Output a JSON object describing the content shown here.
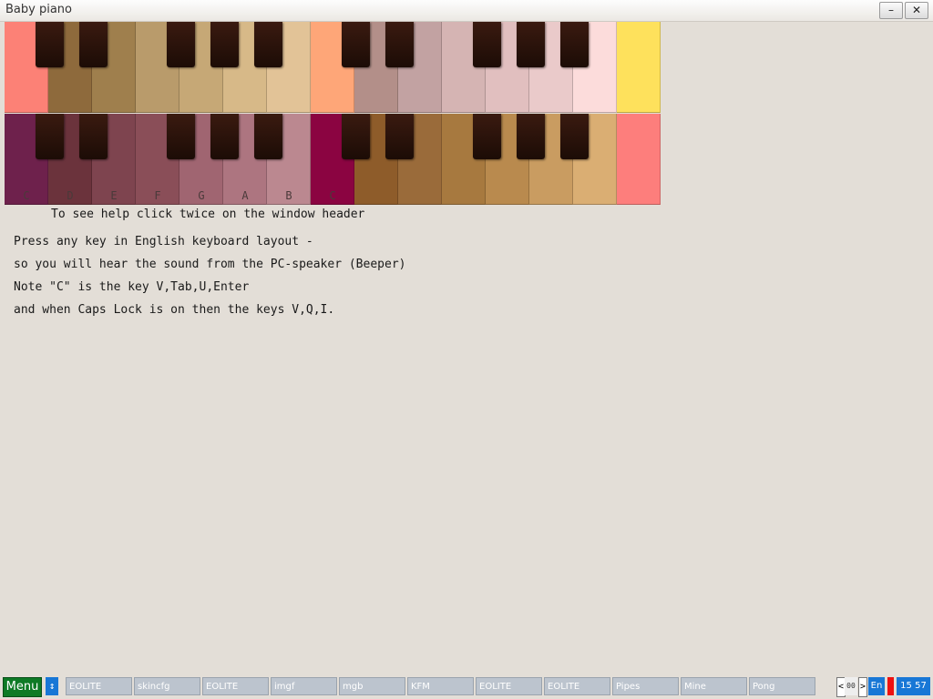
{
  "window": {
    "title": "Baby piano",
    "minimize_label": "–",
    "close_label": "✕"
  },
  "piano": {
    "upper_colors": [
      "#fc8176",
      "#8e6a3c",
      "#9f7f4d",
      "#b99b6b",
      "#c6a876",
      "#d7b988",
      "#e2c397",
      "#fea678",
      "#b38f89",
      "#c2a2a2",
      "#d5b4b3",
      "#e1bfbf",
      "#eacaca",
      "#fcdcdb",
      "#fee15c"
    ],
    "lower_colors": [
      "#6e214c",
      "#6b333c",
      "#7e444f",
      "#8a4e58",
      "#a06571",
      "#ad7580",
      "#bb8890",
      "#8b0441",
      "#8e5c2a",
      "#9a6b3a",
      "#a7793f",
      "#b98a4e",
      "#c99c61",
      "#daae73",
      "#fd7e7c"
    ],
    "note_labels": [
      "C",
      "D",
      "E",
      "F",
      "G",
      "A",
      "B",
      "C"
    ]
  },
  "help": {
    "header_hint": "To see help click twice on the window header",
    "line1": "Press any key in English keyboard layout -",
    "line2": "so you will hear the sound from the PC-speaker (Beeper)",
    "line3": "Note \"C\" is the key V,Tab,U,Enter",
    "line4": "and when Caps Lock is on then the keys V,Q,I."
  },
  "taskbar": {
    "menu_label": "Menu",
    "sort_icon": "↕",
    "tasks": [
      "EOLITE",
      "skincfg",
      "EOLITE",
      "imgf",
      "mgb",
      "KFM",
      "EOLITE",
      "EOLITE",
      "Pipes",
      "Mine",
      "Pong"
    ],
    "workspace": "00",
    "left_arrow": "<",
    "right_arrow": ">",
    "language": "En",
    "clock": "15 57"
  }
}
